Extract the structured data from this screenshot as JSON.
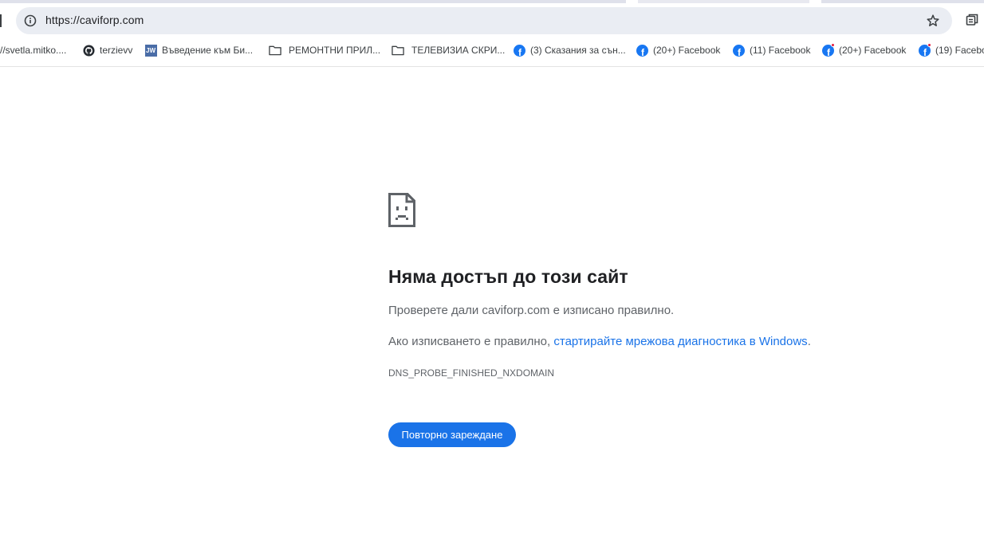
{
  "address_bar": {
    "url": "https://caviforp.com",
    "info_icon": "info-icon",
    "star_icon": "star-icon"
  },
  "bookmarks": [
    {
      "label": "//svetla.mitko....",
      "icon": "none"
    },
    {
      "label": "terzievv",
      "icon": "github-icon"
    },
    {
      "label": "Въведение към Би...",
      "icon": "jw-icon",
      "icon_text": "JW"
    },
    {
      "label": "РЕМОНТНИ ПРИЛ...",
      "icon": "folder-icon"
    },
    {
      "label": "ТЕЛЕВИЗИА СКРИ...",
      "icon": "folder-icon"
    },
    {
      "label": "(3) Сказания за сън...",
      "icon": "facebook-icon"
    },
    {
      "label": "(20+) Facebook",
      "icon": "facebook-icon"
    },
    {
      "label": "(11) Facebook",
      "icon": "facebook-icon"
    },
    {
      "label": "(20+) Facebook",
      "icon": "facebook-notification-icon"
    },
    {
      "label": "(19) Facebo",
      "icon": "facebook-notification-icon"
    }
  ],
  "error": {
    "icon": "sad-page-icon",
    "title": "Няма достъп до този сайт",
    "line1": "Проверете дали caviforp.com е изписано правилно.",
    "line2_prefix": "Ако изписването е правилно, ",
    "line2_link": "стартирайте мрежова диагностика в Windows",
    "line2_suffix": ".",
    "code": "DNS_PROBE_FINISHED_NXDOMAIN",
    "reload_label": "Повторно зареждане"
  },
  "colors": {
    "accent": "#1a73e8",
    "facebook": "#1877f2",
    "omnibox_bg": "#eaedf3"
  }
}
